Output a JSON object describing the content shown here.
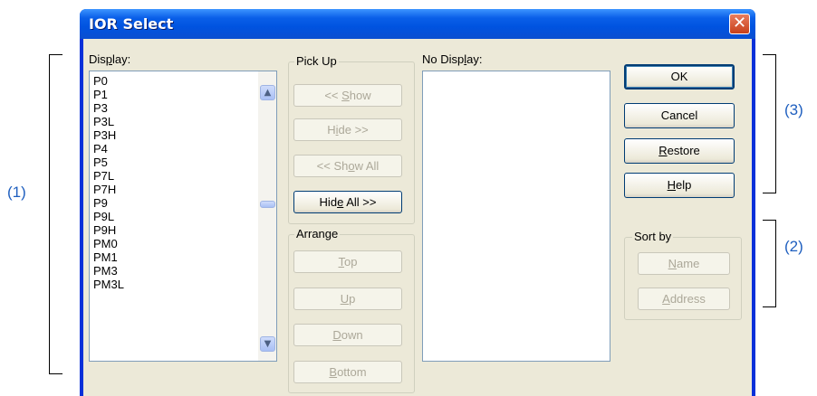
{
  "window": {
    "title": "IOR Select"
  },
  "callouts": {
    "c1": "(1)",
    "c2": "(2)",
    "c3": "(3)"
  },
  "display": {
    "label_pre": "Dis",
    "label_u": "p",
    "label_post": "lay:",
    "items": [
      "P0",
      "P1",
      "P3",
      "P3L",
      "P3H",
      "P4",
      "P5",
      "P7L",
      "P7H",
      "P9",
      "P9L",
      "P9H",
      "PM0",
      "PM1",
      "PM3",
      "PM3L"
    ]
  },
  "pickup": {
    "title": "Pick Up",
    "show": {
      "pre": "<< ",
      "u": "S",
      "post": "how",
      "enabled": false
    },
    "hide": {
      "pre": "H",
      "u": "i",
      "post": "de >>",
      "enabled": false
    },
    "show_all": {
      "pre": "<< Sh",
      "u": "o",
      "post": "w All",
      "enabled": false
    },
    "hide_all": {
      "pre": "Hid",
      "u": "e",
      "post": " All >>",
      "enabled": true
    }
  },
  "arrange": {
    "title": "Arrange",
    "top": {
      "pre": "",
      "u": "T",
      "post": "op"
    },
    "up": {
      "pre": "",
      "u": "U",
      "post": "p"
    },
    "down": {
      "pre": "",
      "u": "D",
      "post": "own"
    },
    "bottom": {
      "pre": "",
      "u": "B",
      "post": "ottom"
    }
  },
  "nodisplay": {
    "label_pre": "No Disp",
    "label_u": "l",
    "label_post": "ay:",
    "items": []
  },
  "actions": {
    "ok": "OK",
    "cancel": "Cancel",
    "restore": {
      "pre": "",
      "u": "R",
      "post": "estore"
    },
    "help": {
      "pre": "",
      "u": "H",
      "post": "elp"
    }
  },
  "sortby": {
    "title": "Sort by",
    "name": {
      "pre": "",
      "u": "N",
      "post": "ame"
    },
    "address": {
      "pre": "",
      "u": "A",
      "post": "ddress"
    }
  },
  "colors": {
    "title_bar": "#0a5fe8",
    "client_bg": "#ece9d8",
    "callout": "#1f5fbf",
    "close": "#c7401a"
  }
}
